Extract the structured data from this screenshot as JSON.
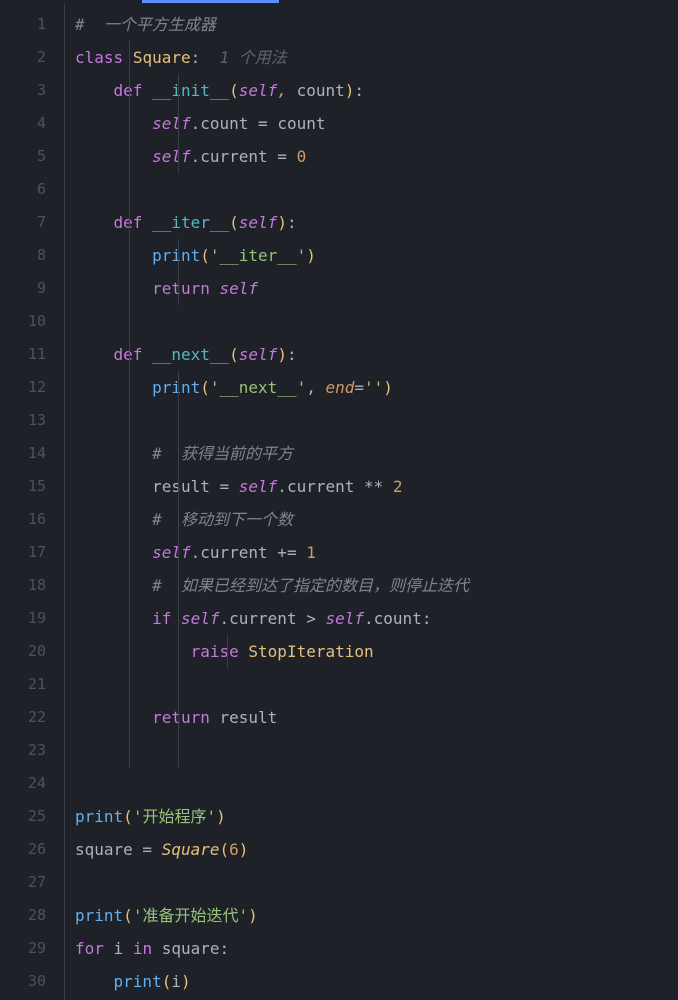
{
  "lineNumbers": [
    "1",
    "2",
    "3",
    "4",
    "5",
    "6",
    "7",
    "8",
    "9",
    "10",
    "11",
    "12",
    "13",
    "14",
    "15",
    "16",
    "17",
    "18",
    "19",
    "20",
    "21",
    "22",
    "23",
    "24",
    "25",
    "26",
    "27",
    "28",
    "29",
    "30"
  ],
  "code": {
    "l1_c1": "#  一个平方生成器",
    "l2_kw": "class",
    "l2_cls": "Square",
    "l2_colon": ":",
    "l2_hint": "  1 个用法",
    "l3_kw": "def",
    "l3_name": "__init__",
    "l3_lp": "(",
    "l3_self": "self",
    "l3_comma": ", ",
    "l3_p1": "count",
    "l3_rp": ")",
    "l3_colon": ":",
    "l4_self": "self",
    "l4_dot": ".",
    "l4_attr": "count",
    "l4_eq": " = ",
    "l4_rhs": "count",
    "l5_self": "self",
    "l5_dot": ".",
    "l5_attr": "current",
    "l5_eq": " = ",
    "l5_num": "0",
    "l7_kw": "def",
    "l7_name": "__iter__",
    "l7_lp": "(",
    "l7_self": "self",
    "l7_rp": ")",
    "l7_colon": ":",
    "l8_fn": "print",
    "l8_lp": "(",
    "l8_str": "'__iter__'",
    "l8_rp": ")",
    "l9_kw": "return",
    "l9_self": "self",
    "l11_kw": "def",
    "l11_name": "__next__",
    "l11_lp": "(",
    "l11_self": "self",
    "l11_rp": ")",
    "l11_colon": ":",
    "l12_fn": "print",
    "l12_lp": "(",
    "l12_str": "'__next__'",
    "l12_comma": ", ",
    "l12_kw": "end",
    "l12_eq": "=",
    "l12_str2": "''",
    "l12_rp": ")",
    "l14_c": "#  获得当前的平方",
    "l15_lhs": "result",
    "l15_eq": " = ",
    "l15_self": "self",
    "l15_dot": ".",
    "l15_attr": "current",
    "l15_op": " ** ",
    "l15_num": "2",
    "l16_c": "#  移动到下一个数",
    "l17_self": "self",
    "l17_dot": ".",
    "l17_attr": "current",
    "l17_op": " += ",
    "l17_num": "1",
    "l18_c": "#  如果已经到达了指定的数目，则停止迭代",
    "l19_kw": "if",
    "l19_self1": "self",
    "l19_dot1": ".",
    "l19_attr1": "current",
    "l19_op": " > ",
    "l19_self2": "self",
    "l19_dot2": ".",
    "l19_attr2": "count",
    "l19_colon": ":",
    "l20_kw": "raise",
    "l20_cls": "StopIteration",
    "l22_kw": "return",
    "l22_id": "result",
    "l25_fn": "print",
    "l25_lp": "(",
    "l25_str": "'开始程序'",
    "l25_rp": ")",
    "l26_lhs": "square",
    "l26_eq": " = ",
    "l26_cls": "Square",
    "l26_lp": "(",
    "l26_num": "6",
    "l26_rp": ")",
    "l28_fn": "print",
    "l28_lp": "(",
    "l28_str": "'准备开始迭代'",
    "l28_rp": ")",
    "l29_kw": "for",
    "l29_i": "i",
    "l29_in": "in",
    "l29_sq": "square",
    "l29_colon": ":",
    "l30_fn": "print",
    "l30_lp": "(",
    "l30_i": "i",
    "l30_rp": ")"
  }
}
